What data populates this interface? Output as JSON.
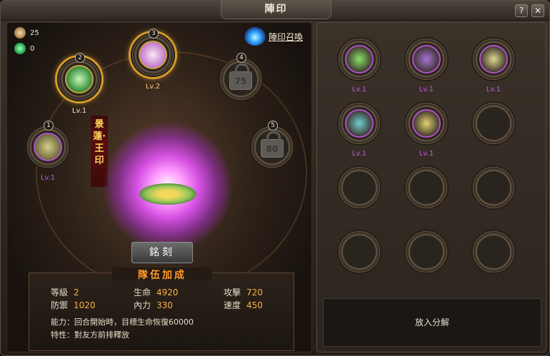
{
  "window": {
    "title": "陣印"
  },
  "title_buttons": {
    "help": "?",
    "close": "✕"
  },
  "resources": [
    {
      "name": "coin-icon",
      "value": "25",
      "color": "#c9a46a"
    },
    {
      "name": "jade-icon",
      "value": "0",
      "color": "#2dcf64"
    }
  ],
  "summon": {
    "label": "陣印召喚",
    "icon": "blue-flame-icon"
  },
  "seal_slots": [
    {
      "number": "1",
      "level": "Lv.1",
      "unlocked": true
    },
    {
      "number": "2",
      "level": "Lv.1",
      "unlocked": true
    },
    {
      "number": "3",
      "level": "Lv.2",
      "unlocked": true,
      "selected": true
    },
    {
      "number": "4",
      "level": "75",
      "unlocked": false
    },
    {
      "number": "5",
      "level": "80",
      "unlocked": false
    }
  ],
  "seal_name_banner": "景蓮‧王印",
  "engrave_button": "銘刻",
  "team_bonus": {
    "title": "隊伍加成",
    "stats": [
      {
        "label": "等級",
        "value": "2"
      },
      {
        "label": "生命",
        "value": "4920"
      },
      {
        "label": "攻擊",
        "value": "720"
      },
      {
        "label": "防禦",
        "value": "1020"
      },
      {
        "label": "內力",
        "value": "330"
      },
      {
        "label": "速度",
        "value": "450"
      }
    ],
    "ability": "能力：回合開始時，目標生命恢復60000",
    "trait": "特性：對友方前排釋放"
  },
  "inventory": {
    "items": [
      {
        "level": "Lv.1",
        "color": "#8be26a"
      },
      {
        "level": "Lv.1",
        "color": "#a673d6"
      },
      {
        "level": "Lv.1",
        "color": "#e0d890"
      },
      {
        "level": "Lv.1",
        "color": "#6fd0d4"
      },
      {
        "level": "Lv.1",
        "color": "#e3d36f"
      },
      {
        "level": "",
        "color": ""
      },
      {
        "level": "",
        "color": ""
      },
      {
        "level": "",
        "color": ""
      },
      {
        "level": "",
        "color": ""
      },
      {
        "level": "",
        "color": ""
      },
      {
        "level": "",
        "color": ""
      },
      {
        "level": "",
        "color": ""
      }
    ]
  },
  "dismantle_label": "放入分解",
  "colors": {
    "accent_orange": "#ffb143",
    "title_orange": "#ff9a2b",
    "level_purple": "#b252c9",
    "highlight_gold": "#d49a2b"
  }
}
